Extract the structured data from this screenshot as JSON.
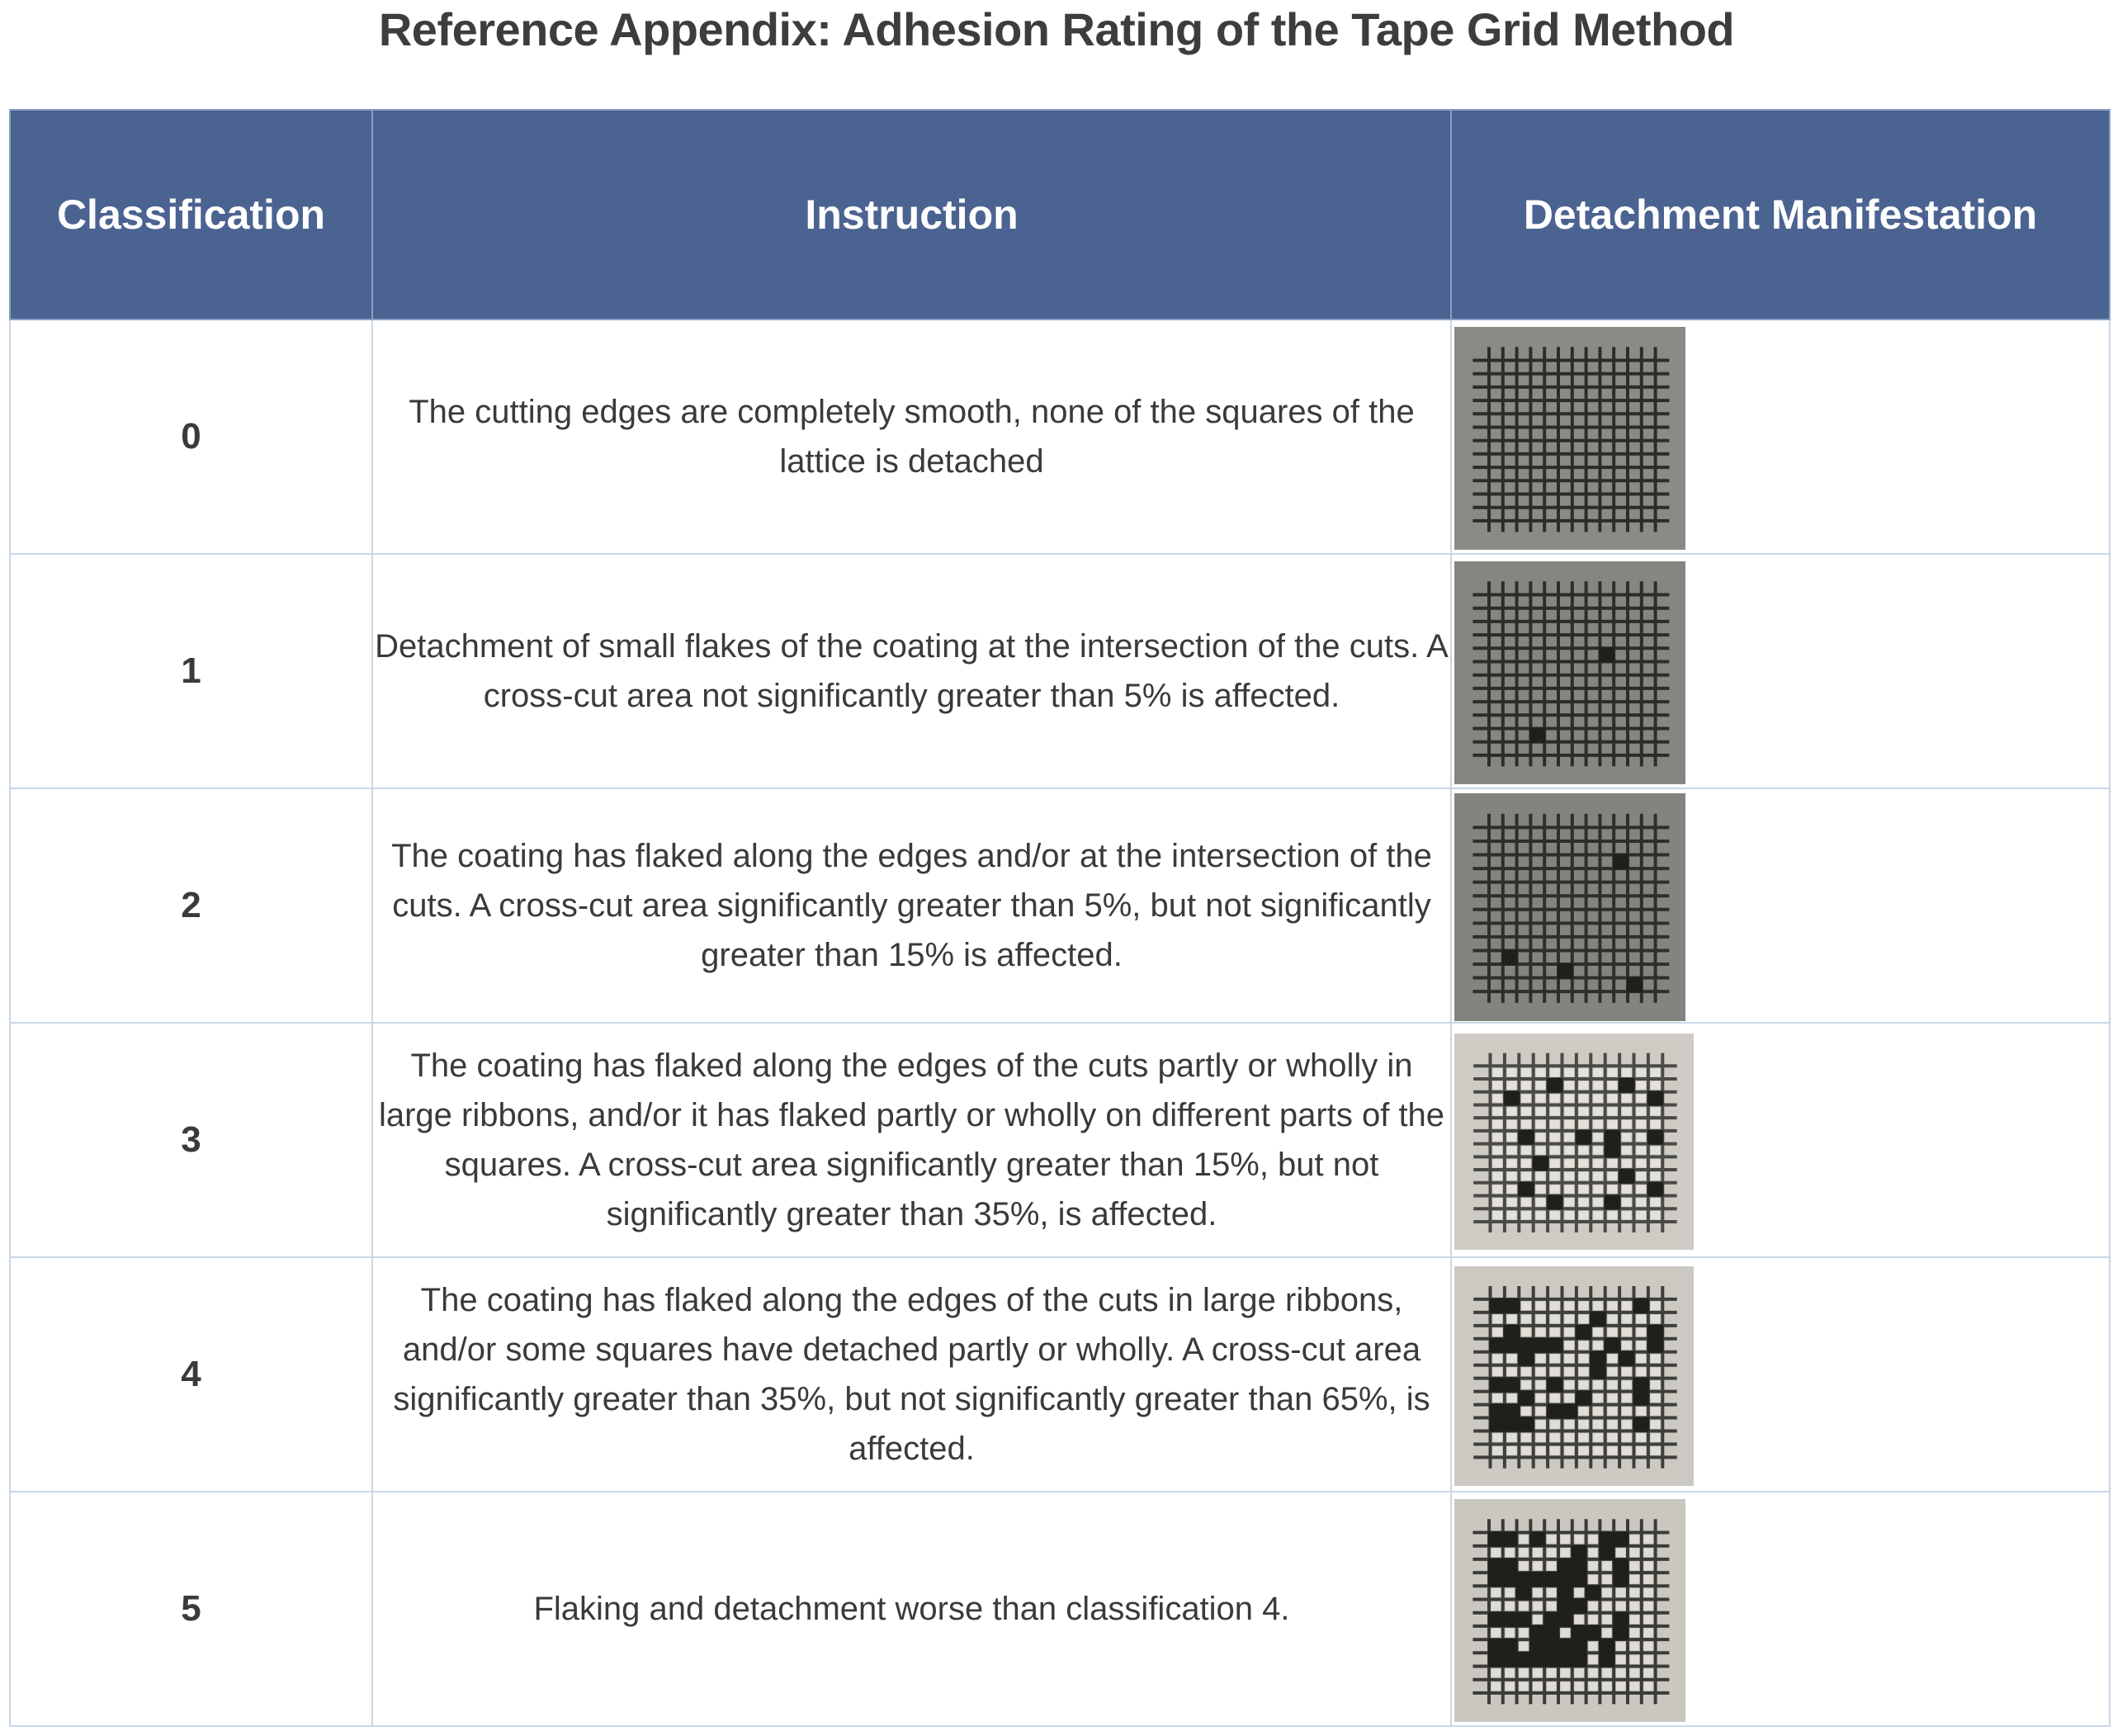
{
  "title": "Reference Appendix: Adhesion Rating of the Tape Grid Method",
  "table": {
    "headers": [
      "Classification",
      "Instruction",
      "Detachment Manifestation"
    ],
    "header_color": "#4b6391",
    "rows": [
      {
        "classification": "0",
        "instruction": "The cutting edges are completely smooth, none of the squares of the lattice is detached",
        "image": "Cross-cut lattice photo, no squares detached"
      },
      {
        "classification": "1",
        "instruction": "Detachment of small flakes of the coating at the intersection of the cuts. A cross-cut area not significantly greater than 5% is affected.",
        "image": "Cross-cut lattice photo, small flakes detached at intersections"
      },
      {
        "classification": "2",
        "instruction": "The coating has flaked along the edges and/or at the intersection of the cuts. A cross-cut area significantly greater than 5%, but not significantly greater than 15% is affected.",
        "image": "Cross-cut lattice photo, flaking along edges and intersections"
      },
      {
        "classification": "3",
        "instruction": "The coating has flaked along the edges of the cuts partly or wholly in large ribbons, and/or it has flaked partly or wholly on different parts of the squares. A cross-cut area significantly greater than 15%, but not significantly greater than 35%, is affected.",
        "image": "Cross-cut lattice photo, flaking in ribbons and on parts of squares"
      },
      {
        "classification": "4",
        "instruction": "The coating has flaked along the edges of the cuts in large ribbons, and/or some squares have detached partly or wholly. A cross-cut area significantly greater than 35%, but not significantly greater than 65%, is affected.",
        "image": "Cross-cut lattice photo, large ribbons and squares detached"
      },
      {
        "classification": "5",
        "instruction": "Flaking and detachment worse than classification 4.",
        "image": "Cross-cut lattice photo, severe flaking and detachment"
      }
    ]
  }
}
